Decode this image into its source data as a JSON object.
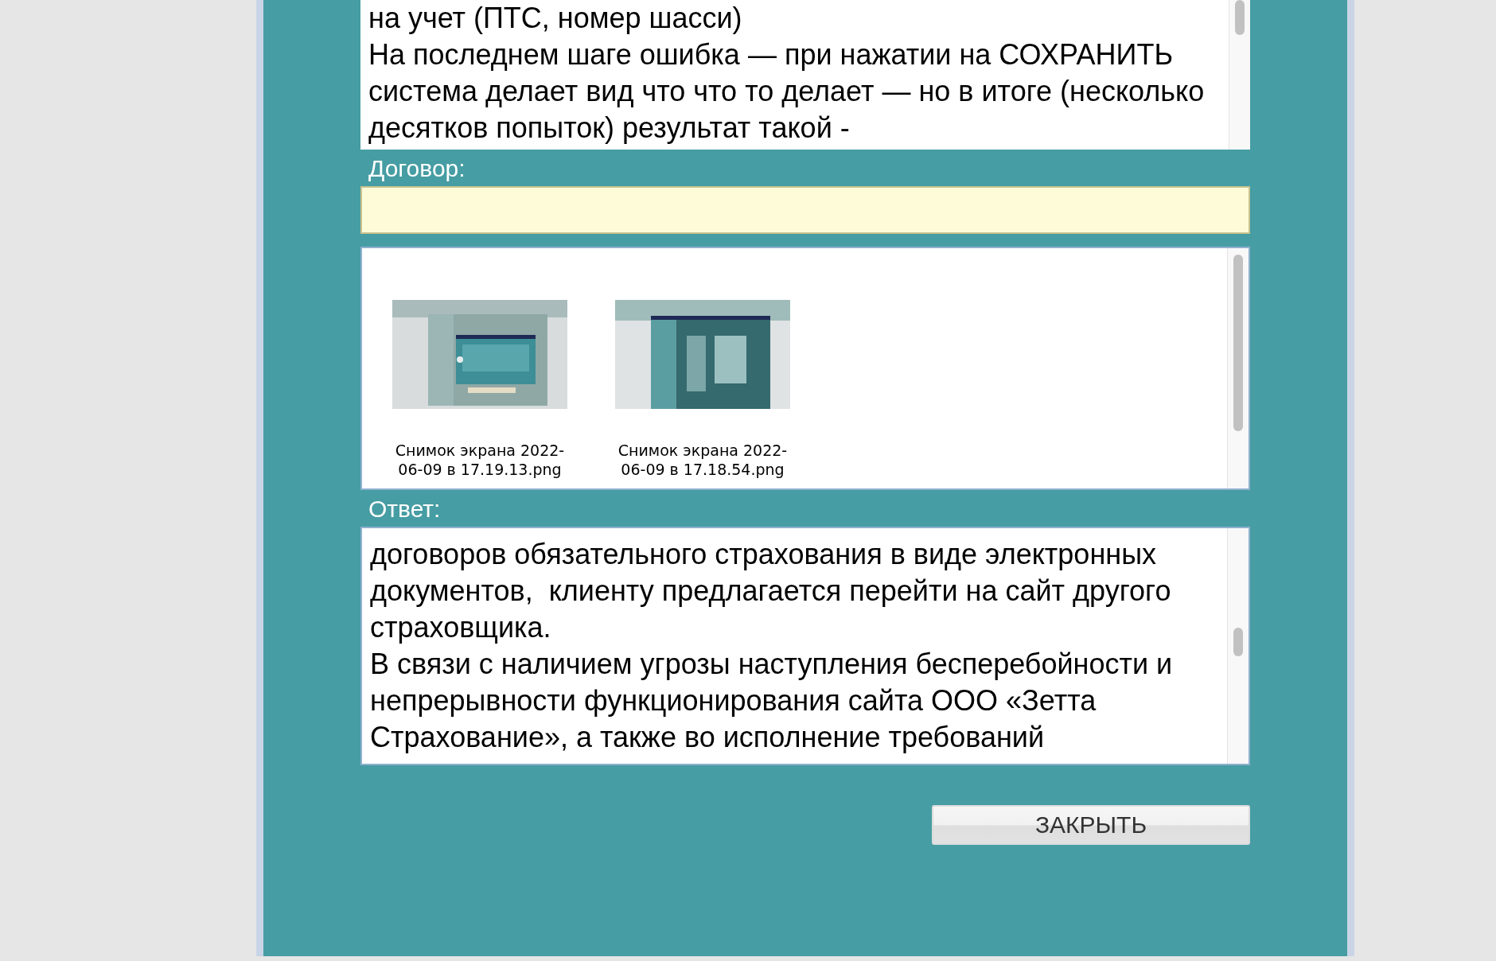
{
  "description": {
    "text": "на учет (ПТС, номер шасси)\nНа последнем шаге ошибка — при нажатии на СОХРАНИТЬ система делает вид что что то делает — но в итоге (несколько десятков попыток) результат такой -"
  },
  "contract": {
    "label": "Договор:"
  },
  "attachments": [
    {
      "kind": "picture",
      "caption": "Снимок экрана 2022-06-09 в 17.19.13.png"
    },
    {
      "kind": "picture",
      "caption": "Снимок экрана 2022-06-09 в 17.18.54.png"
    }
  ],
  "answer": {
    "label": "Ответ:",
    "text": "договоров обязательного страхования в виде электронных документов,  клиенту предлагается перейти на сайт другого страховщика.\nВ связи с наличием угрозы наступления бесперебойности и непрерывности функционирования сайта ООО «Зетта Страхование», а также во исполнение требований"
  },
  "buttons": [
    {
      "label": "ЗАКРЫТЬ"
    }
  ]
}
